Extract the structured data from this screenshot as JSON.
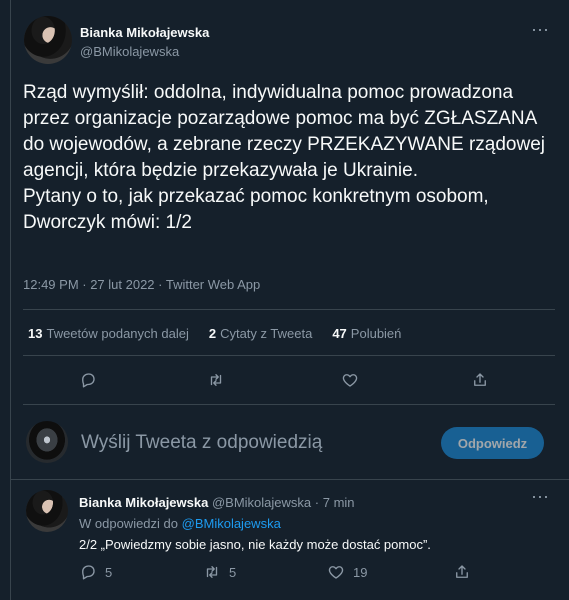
{
  "tweet": {
    "author_name": "Bianka Mikołajewska",
    "author_handle": "@BMikolajewska",
    "text": "Rząd wymyślił: oddolna, indywidualna pomoc prowadzona przez organizacje pozarządowe pomoc ma być ZGŁASZANA do wojewodów, a zebrane rzeczy PRZEKAZYWANE rządowej agencji, która będzie przekazywała je Ukrainie.\nPytany o to, jak przekazać pomoc konkretnym osobom, Dworczyk mówi: 1/2",
    "meta": "12:49 PM · 27 lut 2022 · Twitter Web App",
    "stats": {
      "retweets_count": "13",
      "retweets_label": "Tweetów podanych dalej",
      "quotes_count": "2",
      "quotes_label": "Cytaty z Tweeta",
      "likes_count": "47",
      "likes_label": "Polubień"
    }
  },
  "reply_box": {
    "placeholder": "Wyślij Tweeta z odpowiedzią",
    "button_label": "Odpowiedz"
  },
  "thread_reply": {
    "author_name": "Bianka Mikołajewska",
    "author_handle": "@BMikolajewska",
    "time": "7 min",
    "replying_prefix": "W odpowiedzi do",
    "replying_to": "@BMikolajewska",
    "text": "2/2 „Powiedzmy sobie jasno, nie każdy może dostać pomoc”.",
    "reply_count": "5",
    "retweet_count": "5",
    "like_count": "19"
  },
  "colors": {
    "background": "#15202b",
    "divider": "#38444d",
    "secondary_text": "#8b98a5",
    "accent": "#1d9bf0"
  }
}
